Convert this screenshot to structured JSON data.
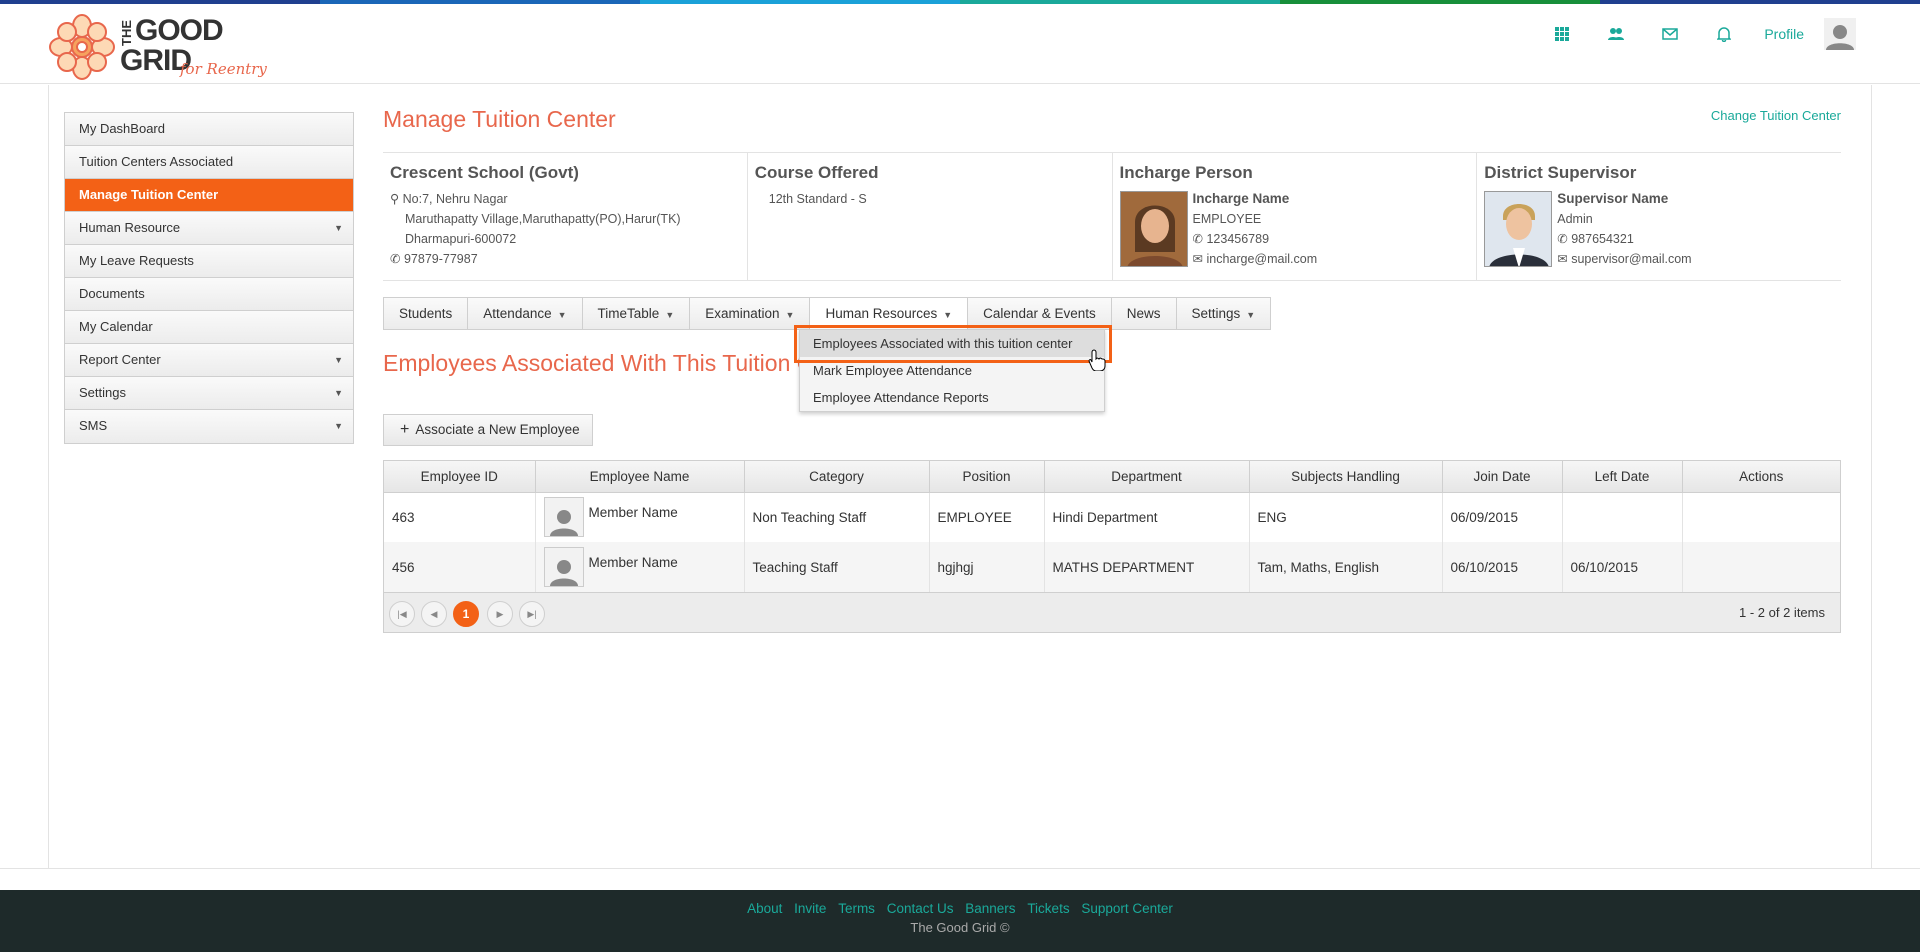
{
  "brand": {
    "logo_text_top": "THE",
    "logo_text_good": "GOOD",
    "logo_text_grid": "GRID",
    "tagline": "for Reentry",
    "accent": "#f36116",
    "teal": "#1aa99a",
    "title_color": "#e8674c"
  },
  "topbar": {
    "icons": [
      "grid-icon",
      "users-icon",
      "mail-icon",
      "bell-icon"
    ],
    "profile_label": "Profile"
  },
  "sidebar": {
    "items": [
      {
        "label": "My DashBoard",
        "active": false,
        "has_sub": false
      },
      {
        "label": "Tuition Centers Associated",
        "active": false,
        "has_sub": false
      },
      {
        "label": "Manage Tuition Center",
        "active": true,
        "has_sub": false
      },
      {
        "label": "Human Resource",
        "active": false,
        "has_sub": true
      },
      {
        "label": "My Leave Requests",
        "active": false,
        "has_sub": false
      },
      {
        "label": "Documents",
        "active": false,
        "has_sub": false
      },
      {
        "label": "My Calendar",
        "active": false,
        "has_sub": false
      },
      {
        "label": "Report Center",
        "active": false,
        "has_sub": true
      },
      {
        "label": "Settings",
        "active": false,
        "has_sub": true
      },
      {
        "label": "SMS",
        "active": false,
        "has_sub": true
      }
    ]
  },
  "main": {
    "page_title": "Manage Tuition Center",
    "change_link": "Change Tuition Center",
    "school": {
      "name": "Crescent School (Govt)",
      "address1": "No:7, Nehru Nagar",
      "address2": "Maruthapatty Village,Maruthapatty(PO),Harur(TK)",
      "address3": "Dharmapuri-600072",
      "phone": "97879-77987"
    },
    "course": {
      "title": "Course Offered",
      "value": "12th Standard - S"
    },
    "incharge": {
      "title": "Incharge Person",
      "name": "Incharge Name",
      "role": "EMPLOYEE",
      "phone": "123456789",
      "email": "incharge@mail.com"
    },
    "supervisor": {
      "title": "District Supervisor",
      "name": "Supervisor Name",
      "role": "Admin",
      "phone": "987654321",
      "email": "supervisor@mail.com"
    },
    "tabs": [
      {
        "label": "Students",
        "dd": false
      },
      {
        "label": "Attendance",
        "dd": true
      },
      {
        "label": "TimeTable",
        "dd": true
      },
      {
        "label": "Examination",
        "dd": true
      },
      {
        "label": "Human Resources",
        "dd": true
      },
      {
        "label": "Calendar & Events",
        "dd": false
      },
      {
        "label": "News",
        "dd": false
      },
      {
        "label": "Settings",
        "dd": true
      }
    ],
    "hr_menu": [
      "Employees Associated with this tuition center",
      "Mark Employee Attendance",
      "Employee Attendance Reports"
    ],
    "section_title": "Employees Associated With This Tuition Center",
    "assoc_button": "Associate a New Employee",
    "table": {
      "headers": [
        "Employee ID",
        "Employee Name",
        "Category",
        "Position",
        "Department",
        "Subjects Handling",
        "Join Date",
        "Left Date",
        "Actions"
      ],
      "rows": [
        [
          "463",
          "Member Name",
          "Non Teaching Staff",
          "EMPLOYEE",
          "Hindi Department",
          "ENG",
          "06/09/2015",
          "",
          ""
        ],
        [
          "456",
          "Member Name",
          "Teaching Staff",
          "hgjhgj",
          "MATHS DEPARTMENT",
          "Tam, Maths, English",
          "06/10/2015",
          "06/10/2015",
          ""
        ]
      ]
    },
    "pager": {
      "current_page": "1",
      "info": "1 - 2 of 2 items"
    }
  },
  "footer": {
    "links": [
      "About",
      "Invite",
      "Terms",
      "Contact Us",
      "Banners",
      "Tickets",
      "Support Center"
    ],
    "copyright": "The Good Grid ©"
  }
}
